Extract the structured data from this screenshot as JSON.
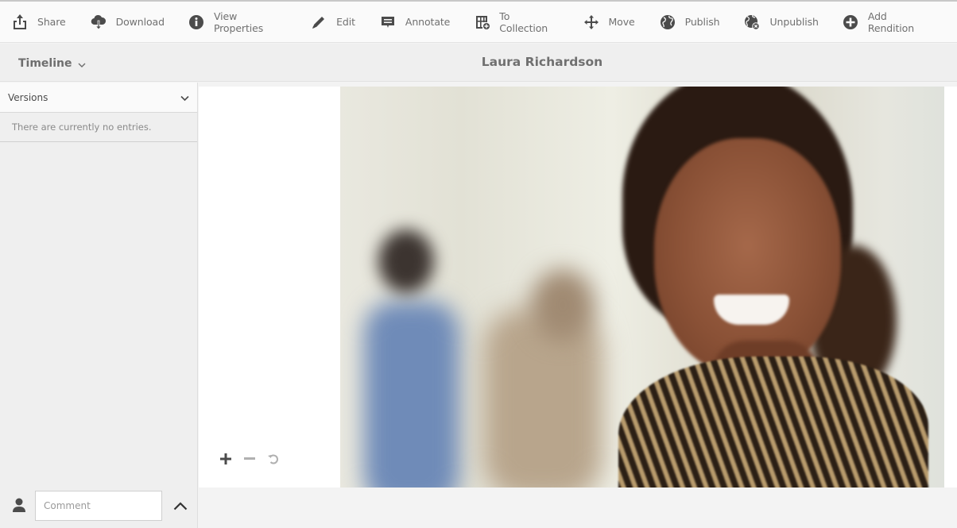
{
  "toolbar": {
    "items": [
      {
        "label": "Share",
        "icon": "share-icon"
      },
      {
        "label": "Download",
        "icon": "download-icon"
      },
      {
        "label": "View Properties",
        "icon": "info-icon"
      },
      {
        "label": "Edit",
        "icon": "pencil-icon"
      },
      {
        "label": "Annotate",
        "icon": "annotate-icon"
      },
      {
        "label": "To Collection",
        "icon": "collection-icon"
      },
      {
        "label": "Move",
        "icon": "move-icon"
      },
      {
        "label": "Publish",
        "icon": "globe-icon"
      },
      {
        "label": "Unpublish",
        "icon": "globe-x-icon"
      },
      {
        "label": "Add Rendition",
        "icon": "plus-circle-icon"
      }
    ]
  },
  "subbar": {
    "rail_selector": "Timeline",
    "asset_title": "Laura Richardson"
  },
  "rail": {
    "versions_label": "Versions",
    "empty_text": "There are currently no entries.",
    "comment_placeholder": "Comment"
  },
  "preview": {
    "image_alt": "Smiling woman in striped blouse with blurred colleagues in background",
    "zoom_controls": [
      "zoom-in",
      "zoom-out",
      "reset-zoom"
    ]
  },
  "colors": {
    "icon": "#4b4b4b",
    "label": "#707070",
    "toolbar_bg": "#fafafa",
    "subbar_bg": "#efefef"
  }
}
